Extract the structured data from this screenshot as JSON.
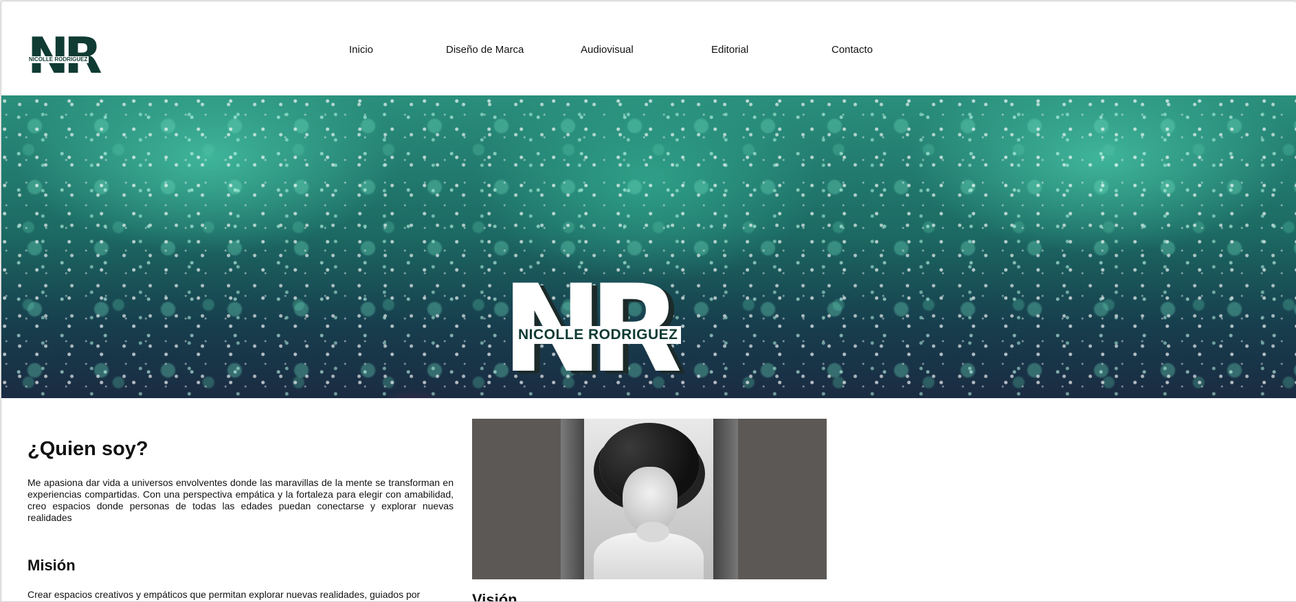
{
  "header": {
    "logo_letters": "NR",
    "logo_tagline": "NICOLLE RODRIGUEZ",
    "nav": [
      {
        "label": "Inicio"
      },
      {
        "label": "Diseño de Marca"
      },
      {
        "label": "Audiovisual"
      },
      {
        "label": "Editorial"
      },
      {
        "label": "Contacto"
      }
    ]
  },
  "hero": {
    "logo_letters": "NR",
    "logo_name": "NICOLLE RODRIGUEZ"
  },
  "about": {
    "title": "¿Quien soy?",
    "text": "Me apasiona dar vida a universos envolventes donde las maravillas de la mente se transforman en experiencias compartidas. Con una perspectiva empática y la fortaleza para elegir con amabilidad, creo espacios donde personas de todas las edades puedan conectarse y explorar nuevas realidades"
  },
  "mision": {
    "title": "Misión",
    "text": "Crear espacios creativos y empáticos que permitan explorar nuevas realidades, guiados por"
  },
  "vision": {
    "title": "Visión"
  },
  "colors": {
    "brand_dark_green": "#0f3b33",
    "hero_teal": "#2a8f7c",
    "photo_frame": "#5c5855"
  }
}
